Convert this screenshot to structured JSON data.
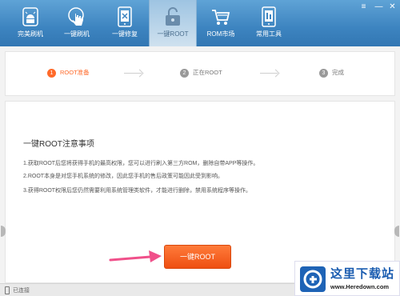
{
  "window_controls": {
    "menu": "≡",
    "minimize": "—",
    "close": "✕"
  },
  "nav": {
    "items": [
      {
        "label": "完美刷机",
        "icon": "android-robot-icon",
        "active": false
      },
      {
        "label": "一键刷机",
        "icon": "touch-hand-icon",
        "active": false
      },
      {
        "label": "一键修复",
        "icon": "phone-repair-icon",
        "active": false
      },
      {
        "label": "一键ROOT",
        "icon": "unlock-icon",
        "active": true
      },
      {
        "label": "ROM市场",
        "icon": "shopping-cart-icon",
        "active": false
      },
      {
        "label": "常用工具",
        "icon": "phone-tools-icon",
        "active": false
      }
    ]
  },
  "steps": [
    {
      "num": "1",
      "label": "ROOT准备",
      "active": true
    },
    {
      "num": "2",
      "label": "正在ROOT",
      "active": false
    },
    {
      "num": "3",
      "label": "完成",
      "active": false
    }
  ],
  "notice": {
    "title": "一键ROOT注意事项",
    "lines": [
      "1.获取ROOT后您将获得手机的最高权限，您可以进行刷入第三方ROM，删除自带APP等操作。",
      "2.ROOT本身是对您手机系统的修改，因此您手机的售后政策可能因此受到影响。",
      "3.获得ROOT权限后您仍然需要利用系统管理类软件，才能进行删除，禁用系统程序等操作。"
    ]
  },
  "root_button": {
    "label": "一键ROOT"
  },
  "status": {
    "text": "已连接"
  },
  "watermark": {
    "name": "这里下载站",
    "url": "www.Heredown.com"
  },
  "colors": {
    "toolbar": "#4a90c9",
    "accent": "#ff6a2a",
    "pointer": "#f0508a"
  }
}
